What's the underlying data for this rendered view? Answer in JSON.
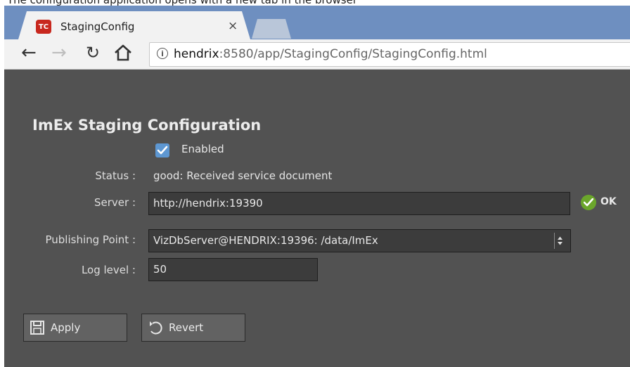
{
  "caption": "The configuration application opens with a new tab in the browser",
  "browser": {
    "tab_title": "StagingConfig",
    "tab_icon_text": "TC",
    "close_glyph": "×",
    "url_host": "hendrix",
    "url_rest": ":8580/app/StagingConfig/StagingConfig.html"
  },
  "page": {
    "title": "ImEx Staging Configuration",
    "enabled_label": "Enabled",
    "enabled_checked": true,
    "status_label": "Status :",
    "status_value": "good: Received service document",
    "server_label": "Server :",
    "server_value": "http://hendrix:19390",
    "server_ok_label": "OK",
    "publishing_point_label": "Publishing Point :",
    "publishing_point_value": "VizDbServer@HENDRIX:19396: /data/ImEx",
    "log_level_label": "Log level :",
    "log_level_value": "50",
    "apply_label": "Apply",
    "revert_label": "Revert"
  },
  "colors": {
    "content_bg": "#525252",
    "checkbox": "#5d97d2",
    "ok_green": "#6ba62b",
    "chrome_frame": "#6e8fc0"
  }
}
